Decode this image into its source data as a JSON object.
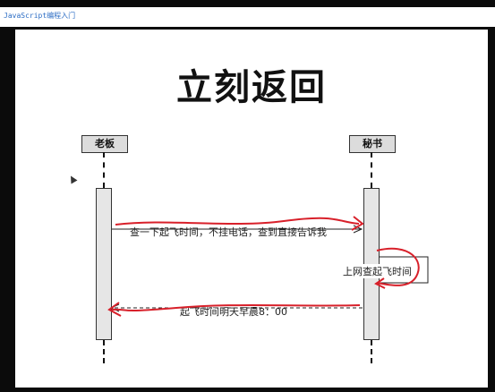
{
  "header": {
    "course_link": "JavaScript编程入门"
  },
  "slide": {
    "title": "立刻返回",
    "actors": {
      "left": "老板",
      "right": "秘书"
    },
    "messages": {
      "request": "查一下起飞时间，不挂电话，查到直接告诉我",
      "self_call": "上网查起飞时间",
      "reply": "起飞时间明天早晨8：00"
    }
  },
  "colors": {
    "annotation": "#d8202a",
    "link": "#2b6cc4"
  }
}
